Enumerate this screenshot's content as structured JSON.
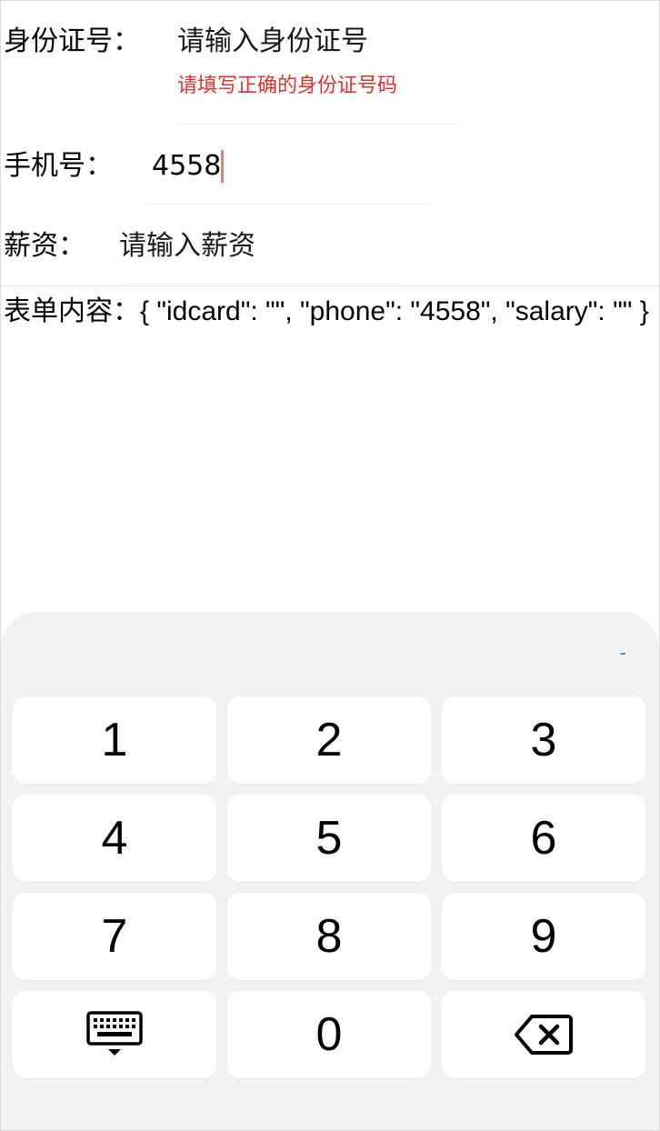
{
  "form": {
    "idcard": {
      "label": "身份证号：",
      "placeholder": "请输入身份证号",
      "error": "请填写正确的身份证号码"
    },
    "phone": {
      "label": "手机号：",
      "value": "4558"
    },
    "salary": {
      "label": "薪资：",
      "placeholder": "请输入薪资"
    }
  },
  "summary": {
    "text": "表单内容：{ \"idcard\": \"\", \"phone\": \"4558\", \"salary\": \"\" }"
  },
  "keyboard": {
    "dash": "-",
    "keys": [
      "1",
      "2",
      "3",
      "4",
      "5",
      "6",
      "7",
      "8",
      "9",
      "0"
    ],
    "icons": {
      "hide": "keyboard-hide-icon",
      "delete": "backspace-icon"
    },
    "colors": {
      "background": "#f1f2f4",
      "key": "#ffffff",
      "accent": "#2a7be4"
    }
  },
  "colors": {
    "error": "#e0322b",
    "caret": "#f07a6a"
  }
}
